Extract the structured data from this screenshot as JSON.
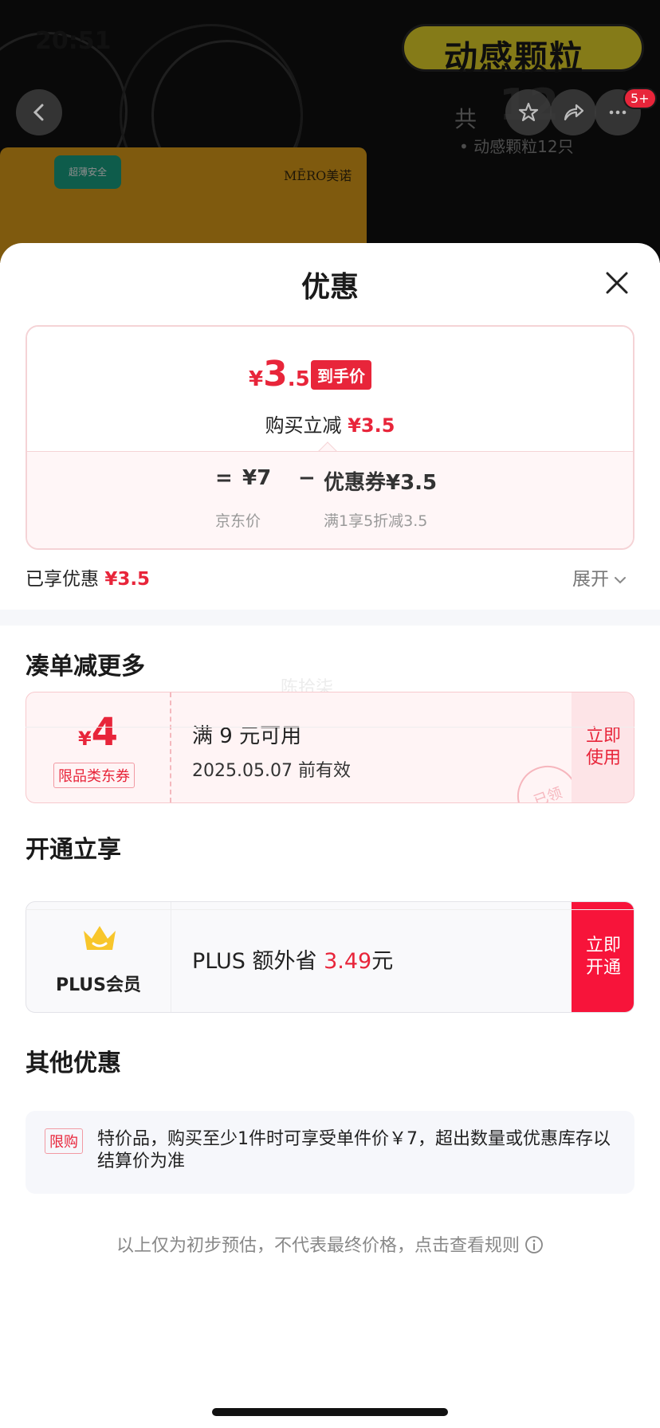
{
  "status_bar": {
    "time": "20:51"
  },
  "product_background": {
    "banner_text": "动感颗粒",
    "count_prefix": "共",
    "count_number": "12",
    "subtitle": "• 动感颗粒12只",
    "brand_left": "超薄安全",
    "brand_right": "MĒRO美诺",
    "cart_badge": "5+"
  },
  "sheet": {
    "title": "优惠",
    "price": {
      "symbol": "¥",
      "integer": "3",
      "decimal": ".5",
      "tag": "到手价",
      "reduction_label": "购买立减",
      "reduction_value": "¥3.5",
      "equals": "=",
      "jd_price": "¥7",
      "jd_price_label": "京东价",
      "minus": "−",
      "coupon_value": "优惠券¥3.5",
      "coupon_label": "满1享5折减3.5"
    },
    "enjoyed_label": "已享优惠",
    "enjoyed_value": "¥3.5",
    "expand_label": "展开"
  },
  "section_more": {
    "title": "凑单减更多",
    "watermark": "陈拾柒",
    "coupon": {
      "symbol": "¥",
      "amount": "4",
      "type": "限品类东券",
      "condition": "满 9 元可用",
      "validity": "2025.05.07 前有效",
      "button": "立即使用",
      "stamp": "已领"
    }
  },
  "section_plus": {
    "title": "开通立享",
    "label": "PLUS会员",
    "text_prefix": "PLUS 额外省",
    "saving": "3.49",
    "text_suffix": "元",
    "button": "立即开通"
  },
  "section_other": {
    "title": "其他优惠",
    "tag": "限购",
    "text": "特价品，购买至少1件时可享受单件价￥7，超出数量或优惠库存以结算价为准"
  },
  "footnote": "以上仅为初步预估，不代表最终价格，点击查看规则",
  "colors": {
    "accent_red": "#e8253a",
    "plus_button": "#f7143a"
  }
}
